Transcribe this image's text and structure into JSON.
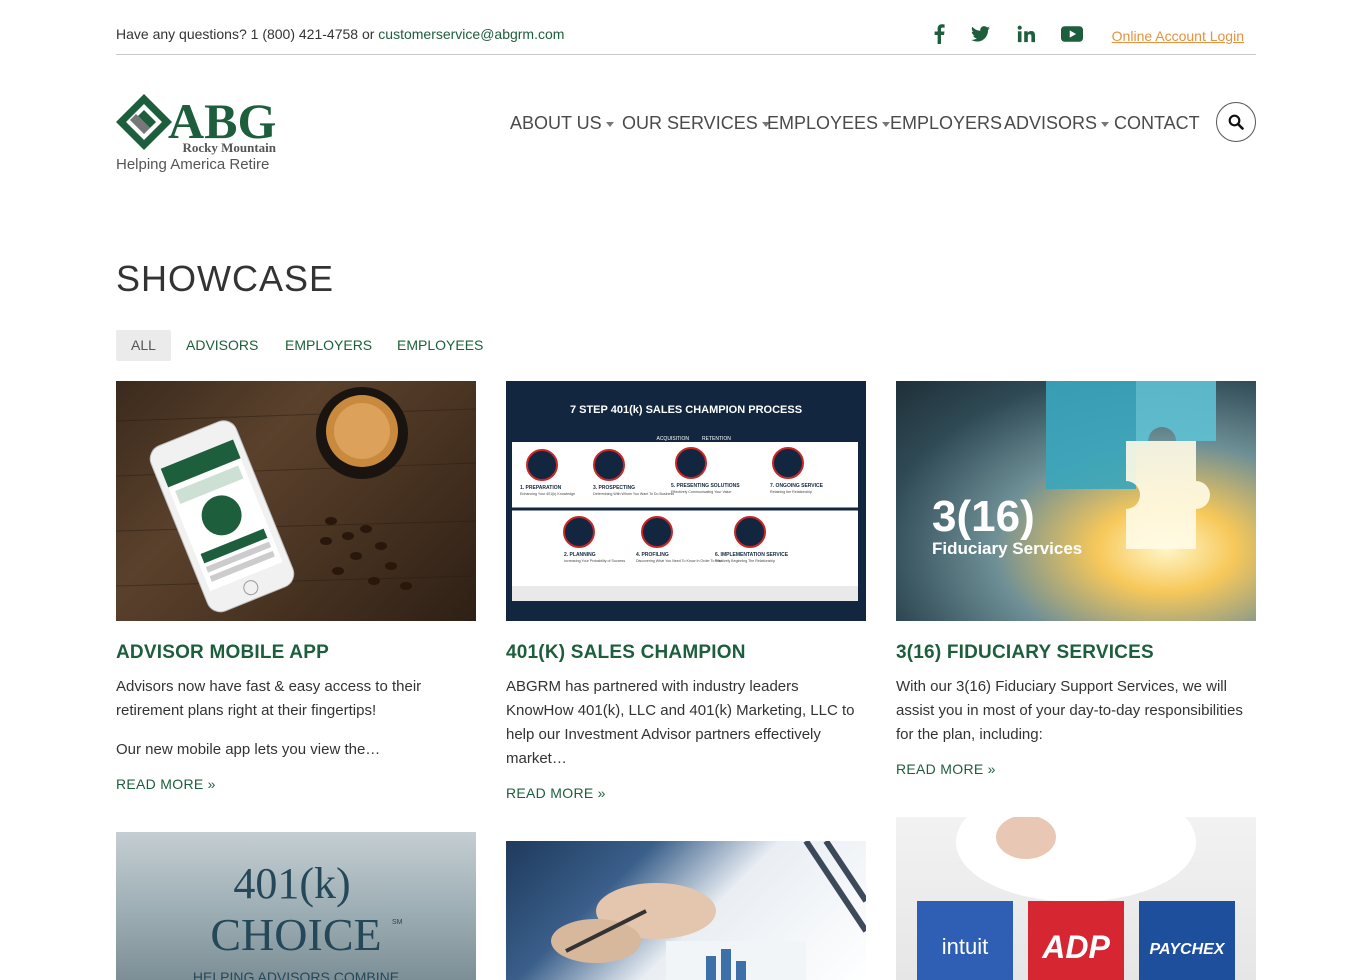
{
  "topbar": {
    "contact_prefix": "Have any questions? 1 (800) 421-4758 or ",
    "email": "customerservice@abgrm.com",
    "login": "Online Account Login",
    "social": [
      "facebook-icon",
      "twitter-icon",
      "linkedin-icon",
      "youtube-icon"
    ]
  },
  "logo": {
    "letters": "ABG",
    "sub": "Rocky Mountain",
    "tagline": "Helping America Retire"
  },
  "nav": {
    "items": [
      {
        "label": "ABOUT US",
        "dropdown": true
      },
      {
        "label": "OUR SERVICES",
        "dropdown": true
      },
      {
        "label": "EMPLOYEES",
        "dropdown": true
      },
      {
        "label": "EMPLOYERS",
        "dropdown": false
      },
      {
        "label": "ADVISORS",
        "dropdown": true
      },
      {
        "label": "CONTACT",
        "dropdown": false
      }
    ]
  },
  "page": {
    "title": "SHOWCASE",
    "filters": [
      "ALL",
      "ADVISORS",
      "EMPLOYERS",
      "EMPLOYEES"
    ],
    "active_filter": "ALL"
  },
  "cards": [
    {
      "title": "ADVISOR MOBILE APP",
      "text1": "Advisors now have fast & easy access to their retirement plans right at their fingertips!",
      "text2": "Our new mobile app lets you view the…",
      "read_more": "READ MORE »"
    },
    {
      "title": "401(K) SALES CHAMPION",
      "text1": "ABGRM has partnered with industry leaders KnowHow 401(k), LLC and 401(k) Marketing, LLC to help our Investment Advisor partners effectively market…",
      "read_more": "READ MORE »",
      "image": {
        "heading": "7 STEP 401(k) SALES CHAMPION PROCESS",
        "phase1": "ACQUISITION",
        "phase2": "RETENTION",
        "steps": [
          {
            "label": "1. PREPARATION",
            "sub": "Enhancing Your 401(k) Knowledge"
          },
          {
            "label": "3. PROSPECTING",
            "sub": "Determining With Whom You Want To Do Business"
          },
          {
            "label": "5. PRESENTING SOLUTIONS",
            "sub": "Effectively Communicating Your Value"
          },
          {
            "label": "7. ONGOING SERVICE",
            "sub": "Retaining the Relationship"
          },
          {
            "label": "2. PLANNING",
            "sub": "Increasing Your Probability of Success"
          },
          {
            "label": "4. PROFILING",
            "sub": "Discovering What You Need To Know In Order To Win"
          },
          {
            "label": "6. IMPLEMENTATION SERVICE",
            "sub": "Positively Beginning The Relationship"
          }
        ]
      }
    },
    {
      "title": "3(16) FIDUCIARY SERVICES",
      "text1": "With our 3(16) Fiduciary Support Services, we will assist you in most of your day-to-day responsibilities for the plan, including:",
      "read_more": "READ MORE »",
      "image": {
        "big": "3(16)",
        "sub": "Fiduciary Services"
      }
    }
  ],
  "bottom_cards": [
    {
      "image": {
        "line1": "401(k)",
        "line2": "CHOICE",
        "sm": "SM",
        "tagline": "HELPING ADVISORS COMBINE"
      }
    },
    {
      "image": {}
    },
    {
      "image": {
        "logos": [
          "intuit",
          "ADP",
          "PAYCHEX"
        ]
      }
    }
  ],
  "colors": {
    "brand_green": "#1d5e3c",
    "login_orange": "#e6923e"
  }
}
